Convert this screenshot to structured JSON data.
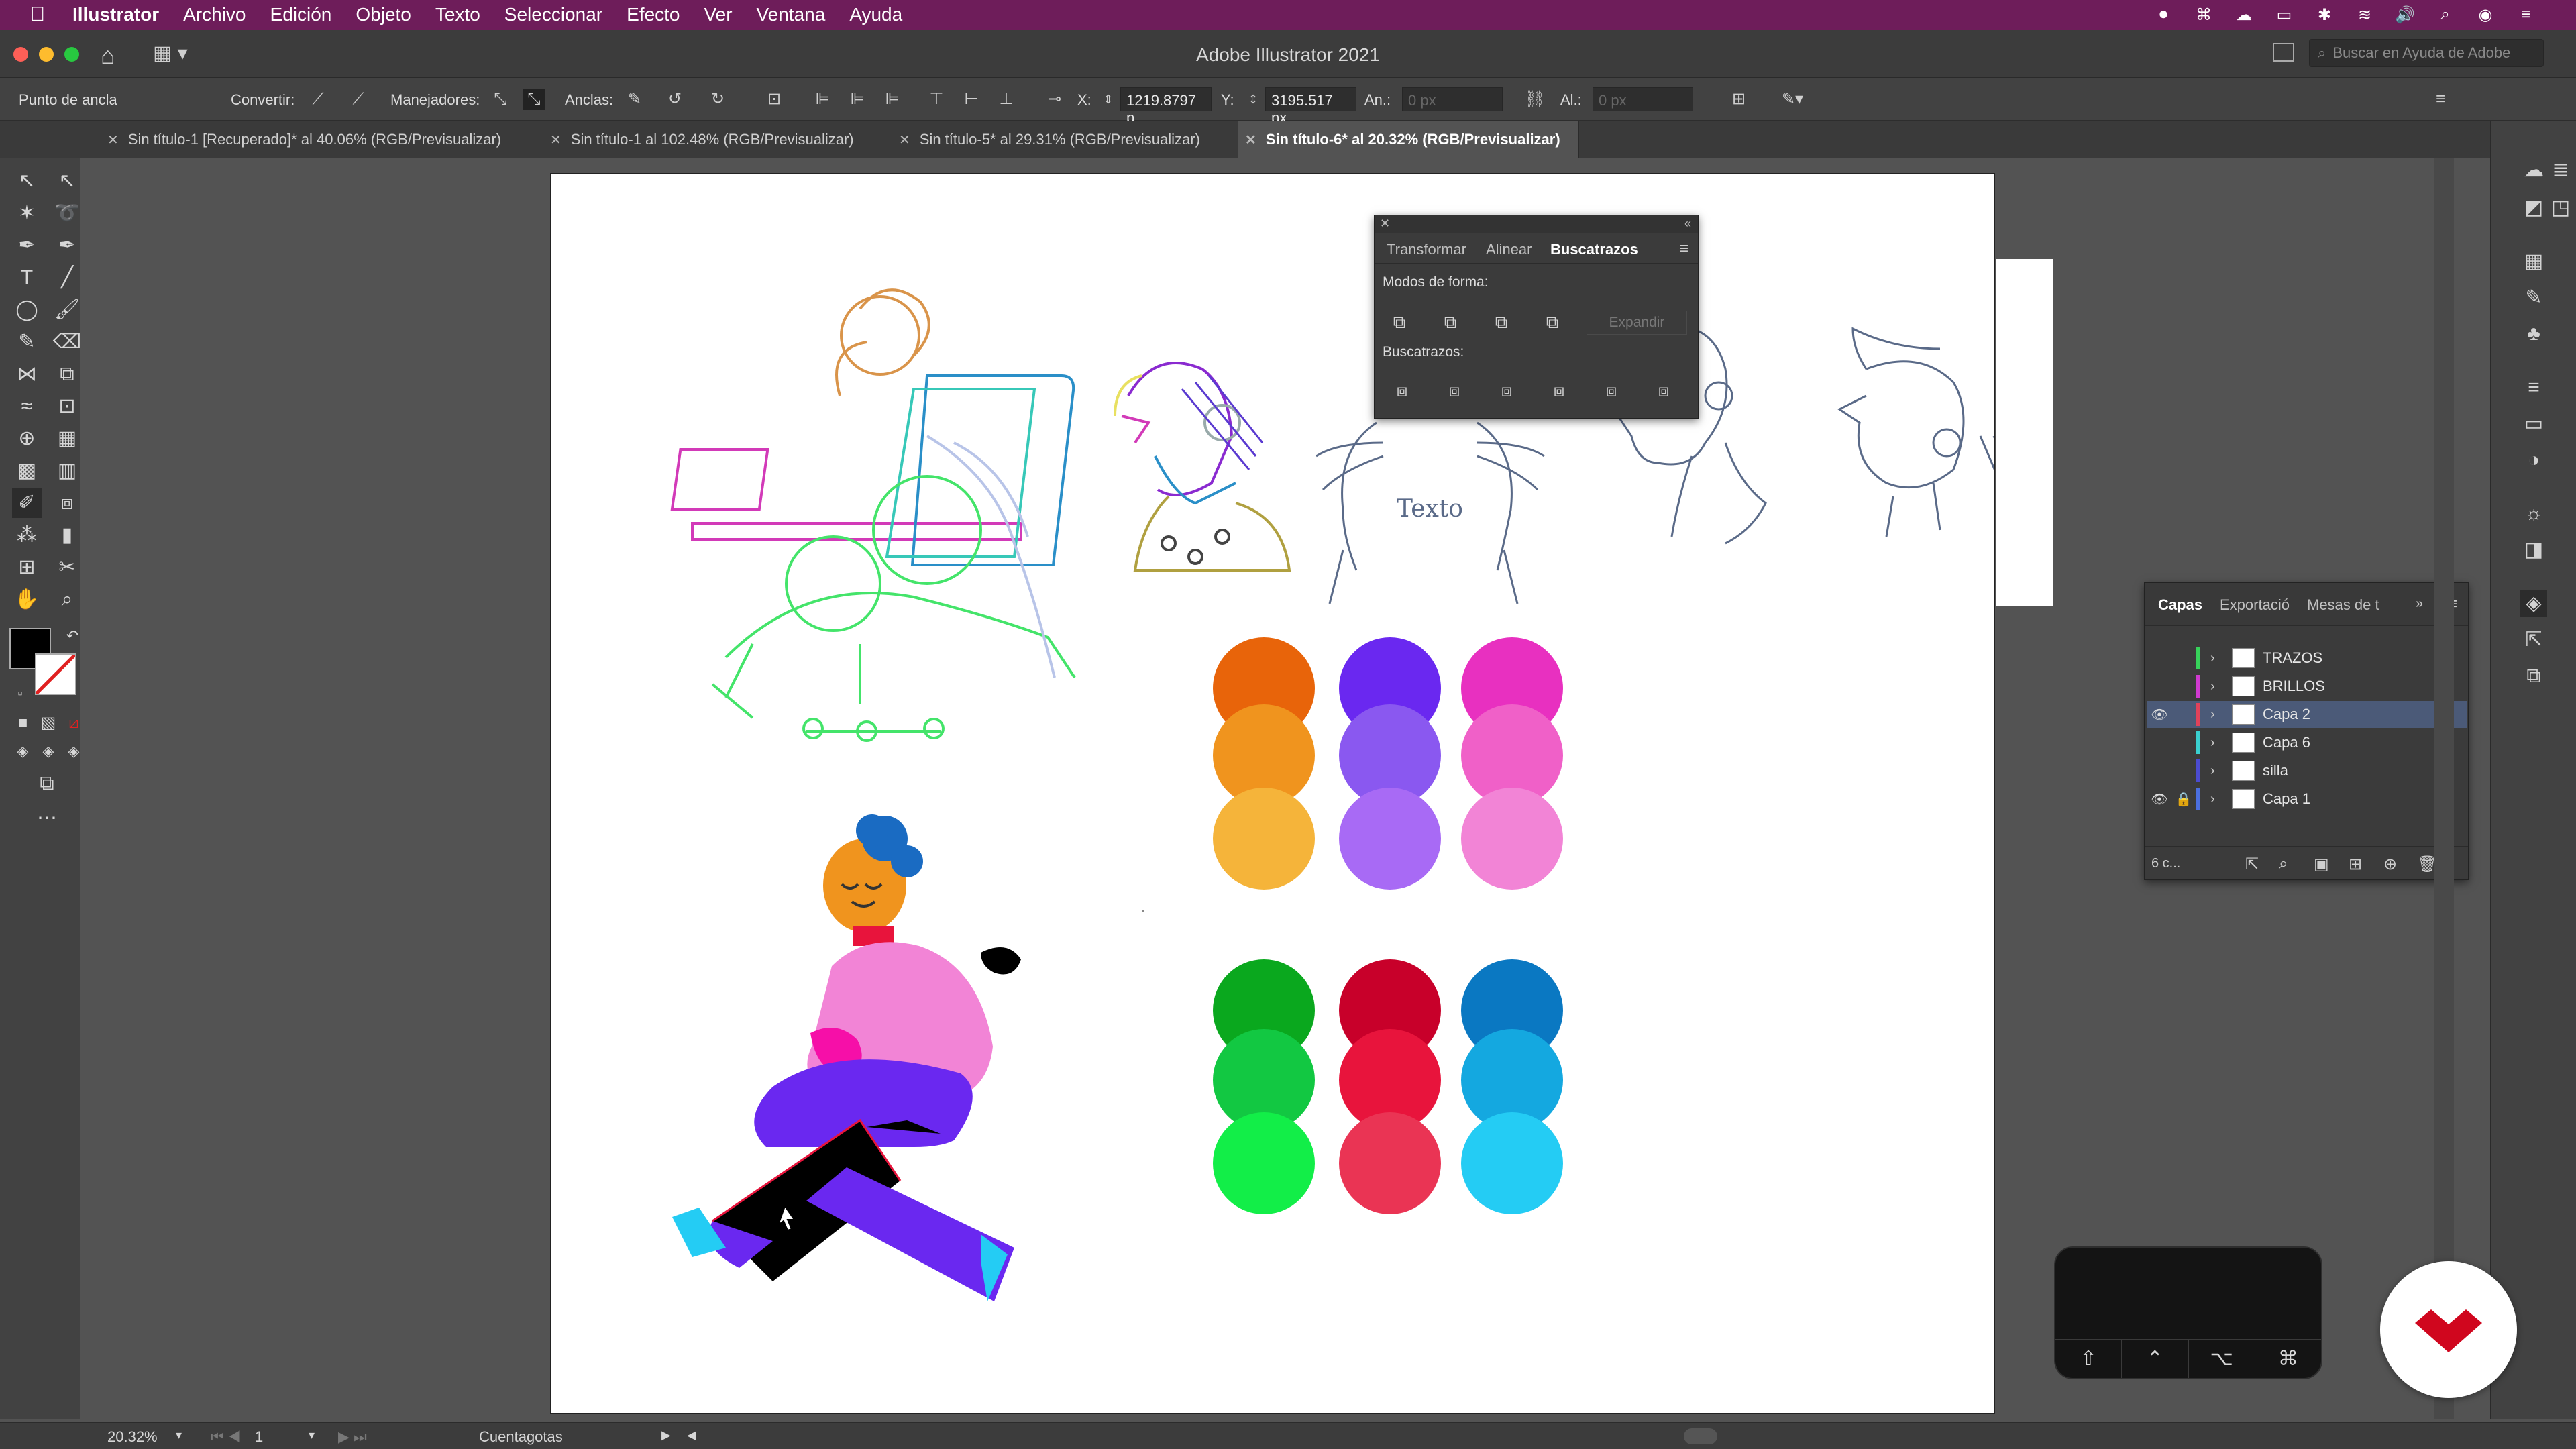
{
  "menubar": {
    "app_name": "Illustrator",
    "items": [
      "Archivo",
      "Edición",
      "Objeto",
      "Texto",
      "Seleccionar",
      "Efecto",
      "Ver",
      "Ventana",
      "Ayuda"
    ]
  },
  "titlebar": {
    "title": "Adobe Illustrator 2021",
    "search_placeholder": "Buscar en Ayuda de Adobe"
  },
  "controlbar": {
    "anchor_label": "Punto de ancla",
    "convert_label": "Convertir:",
    "handles_label": "Manejadores:",
    "anchors_label": "Anclas:",
    "x_label": "X:",
    "x_value": "1219.8797 p",
    "y_label": "Y:",
    "y_value": "3195.517 px",
    "w_label": "An.:",
    "w_value": "0 px",
    "h_label": "Al.:",
    "h_value": "0 px"
  },
  "tabs": [
    "Sin título-1 [Recuperado]* al 40.06% (RGB/Previsualizar)",
    "Sin título-1 al 102.48% (RGB/Previsualizar)",
    "Sin título-5* al 29.31% (RGB/Previsualizar)",
    "Sin título-6* al 20.32% (RGB/Previsualizar)"
  ],
  "canvas": {
    "sketch_text": "Texto"
  },
  "pathfinder": {
    "tabs": [
      "Transformar",
      "Alinear",
      "Buscatrazos"
    ],
    "active_tab": "Buscatrazos",
    "shape_modes_label": "Modos de forma:",
    "expand_label": "Expandir",
    "pathfinders_label": "Buscatrazos:"
  },
  "layers": {
    "tabs": [
      "Capas",
      "Exportació",
      "Mesas de t"
    ],
    "rows": [
      {
        "name": "TRAZOS",
        "color": "#37d25a",
        "visible": false,
        "locked": false,
        "selected": false
      },
      {
        "name": "BRILLOS",
        "color": "#d03ad0",
        "visible": false,
        "locked": false,
        "selected": false
      },
      {
        "name": "Capa 2",
        "color": "#e0425a",
        "visible": true,
        "locked": false,
        "selected": true
      },
      {
        "name": "Capa 6",
        "color": "#3ad0d0",
        "visible": false,
        "locked": false,
        "selected": false
      },
      {
        "name": "silla",
        "color": "#4b4bd0",
        "visible": false,
        "locked": false,
        "selected": false
      },
      {
        "name": "Capa 1",
        "color": "#4b6fe0",
        "visible": true,
        "locked": true,
        "selected": false
      }
    ],
    "count_label": "6 c..."
  },
  "keyboard_overlay": {
    "keys": [
      "⇧",
      "⌃",
      "⌥",
      "⌘"
    ]
  },
  "statusbar": {
    "zoom": "20.32%",
    "artboard": "1",
    "tool": "Cuentagotas"
  },
  "colors": {
    "menubar": "#6e1d5a",
    "swatches": [
      "#e8640a",
      "#f0941e",
      "#f5b43a",
      "#6a28f0",
      "#8a58f0",
      "#a86af5",
      "#e830c0",
      "#f060c8",
      "#f284d6",
      "#0aa81e",
      "#12c842",
      "#12ee48",
      "#c8002a",
      "#e8143c",
      "#ea3454",
      "#0a78c2",
      "#14a8e0",
      "#24ccf4"
    ]
  }
}
